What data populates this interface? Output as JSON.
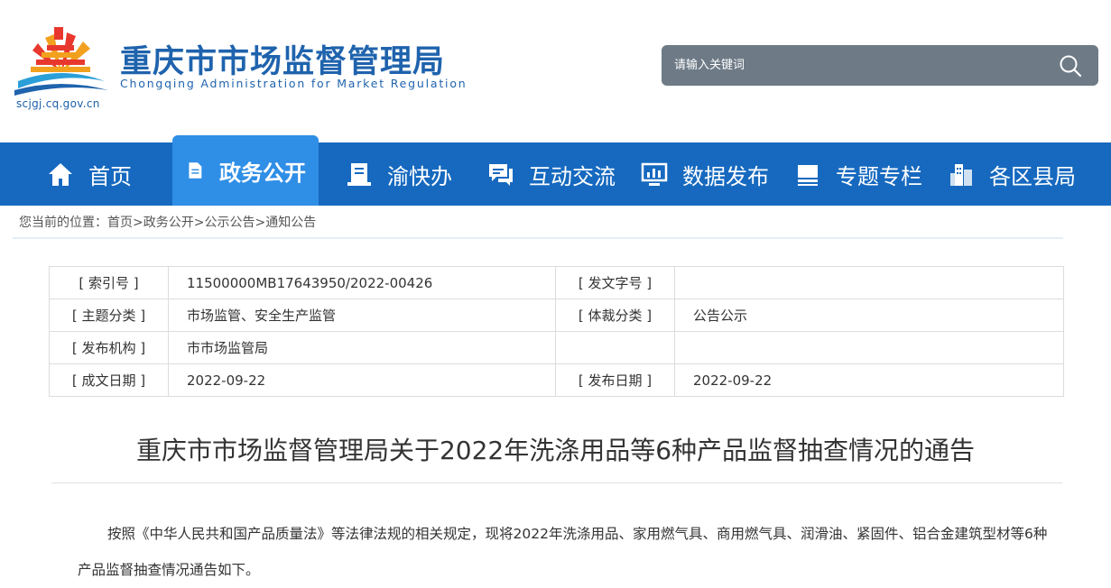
{
  "header": {
    "cn_name": "重庆市市场监督管理局",
    "en_name": "Chongqing  Administration for Market Regulation",
    "url": "scjgj.cq.gov.cn",
    "search_placeholder": "请输入关键词"
  },
  "nav": [
    {
      "label": "首页",
      "icon": "home-icon"
    },
    {
      "label": "政务公开",
      "icon": "document-icon",
      "active": true
    },
    {
      "label": "渝快办",
      "icon": "service-icon"
    },
    {
      "label": "互动交流",
      "icon": "chat-icon"
    },
    {
      "label": "数据发布",
      "icon": "chart-monitor-icon"
    },
    {
      "label": "专题专栏",
      "icon": "column-icon"
    },
    {
      "label": "各区县局",
      "icon": "building-icon"
    }
  ],
  "breadcrumb": "您当前的位置：首页>政务公开>公示公告>通知公告",
  "meta": {
    "index_label": "[ 索引号 ]",
    "index_value": "11500000MB17643950/2022-00426",
    "docno_label": "[ 发文字号 ]",
    "docno_value": "",
    "topic_label": "[ 主题分类 ]",
    "topic_value": "市场监管、安全生产监管",
    "genre_label": "[ 体裁分类 ]",
    "genre_value": "公告公示",
    "org_label": "[ 发布机构 ]",
    "org_value": "市市场监管局",
    "made_label": "[ 成文日期 ]",
    "made_value": "2022-09-22",
    "pub_label": "[ 发布日期 ]",
    "pub_value": "2022-09-22"
  },
  "title": "重庆市市场监督管理局关于2022年洗涤用品等6种产品监督抽查情况的通告",
  "body": "按照《中华人民共和国产品质量法》等法律法规的相关规定，现将2022年洗涤用品、家用燃气具、商用燃气具、润滑油、紧固件、铝合金建筑型材等6种产品监督抽查情况通告如下。"
}
